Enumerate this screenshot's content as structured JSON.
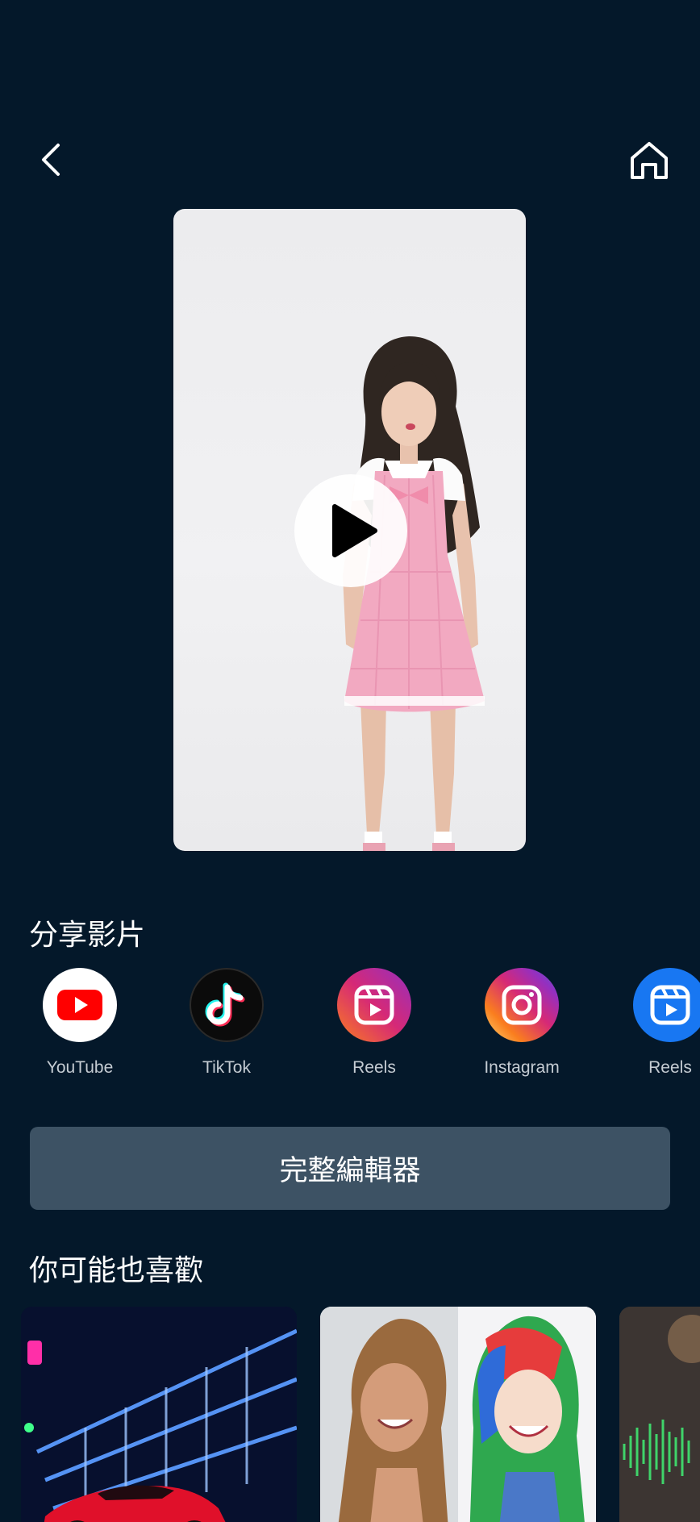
{
  "nav": {
    "back_icon": "chevron-left-icon",
    "home_icon": "home-icon"
  },
  "preview": {
    "play_icon": "play-icon"
  },
  "share": {
    "title": "分享影片",
    "items": [
      {
        "label": "YouTube",
        "icon": "youtube-icon",
        "color": "#ff0000"
      },
      {
        "label": "TikTok",
        "icon": "tiktok-icon",
        "color": "#000000"
      },
      {
        "label": "Reels",
        "icon": "instagram-reels-icon",
        "color": "#d6249f"
      },
      {
        "label": "Instagram",
        "icon": "instagram-icon",
        "color": "#c13584"
      },
      {
        "label": "Reels",
        "icon": "facebook-reels-icon",
        "color": "#1877f2"
      }
    ]
  },
  "editor": {
    "label": "完整編輯器"
  },
  "recommend": {
    "title": "你可能也喜歡"
  },
  "colors": {
    "background": "#04182a",
    "button": "#3d5264"
  }
}
